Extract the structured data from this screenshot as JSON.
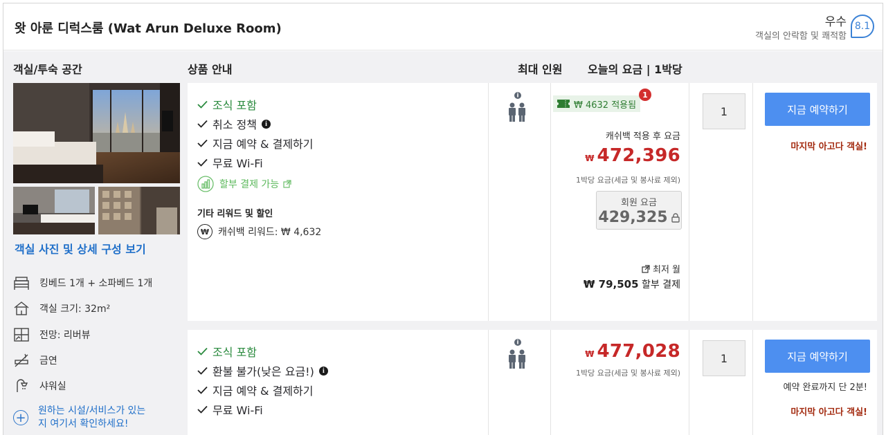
{
  "header": {
    "room_title": "왓 아룬 디럭스룸 (Wat Arun Deluxe Room)",
    "rating_word": "우수",
    "rating_sub": "객실의 안락함 및 쾌적함",
    "score": "8.1"
  },
  "columns": {
    "room": "객실/투숙 공간",
    "product": "상품 안내",
    "occupancy": "최대 인원",
    "price": "오늘의 요금 | 1박당"
  },
  "sidebar": {
    "photo_link": "객실 사진 및 상세 구성 보기",
    "amenities": [
      {
        "label": "킹베드 1개 + 소파베드 1개",
        "icon": "bed-icon"
      },
      {
        "label": "객실 크기: 32m²",
        "icon": "house-icon"
      },
      {
        "label": "전망: 리버뷰",
        "icon": "window-icon"
      },
      {
        "label": "금연",
        "icon": "no-smoking-icon"
      },
      {
        "label": "샤워실",
        "icon": "shower-icon"
      }
    ],
    "more_link": "원하는 시설/서비스가 있는\n지 여기서 확인하세요!"
  },
  "offers": [
    {
      "features": [
        "조식 포함",
        "취소 정책",
        "지금 예약 & 결제하기",
        "무료 Wi-Fi"
      ],
      "installment_label": "할부 결제 가능",
      "other_title": "기타 리워드 및 할인",
      "cashback_reward": "캐쉬백 리워드: ₩ 4,632",
      "cashback_badge": "₩ 4632 적용됨",
      "badge_count": "1",
      "after_label": "캐쉬백 적용 후 요금",
      "currency": "₩",
      "price": "472,396",
      "per_night": "1박당 요금(세금 및 봉사료 제외)",
      "member_label": "회원 요금",
      "member_price": "429,325",
      "lowest_month": "최저 월",
      "install_amount": "₩ 79,505",
      "install_suffix": "할부 결제",
      "quantity": "1",
      "book_label": "지금 예약하기",
      "last_chance": "마지막 아고다 객실!"
    },
    {
      "features": [
        "조식 포함",
        "환불 불가(낮은 요금!)",
        "지금 예약 & 결제하기",
        "무료 Wi-Fi"
      ],
      "currency": "₩",
      "price": "477,028",
      "per_night": "1박당 요금(세금 및 봉사료 제외)",
      "quantity": "1",
      "book_label": "지금 예약하기",
      "urgency": "예약 완료까지 단 2분!",
      "last_chance": "마지막 아고다 객실!"
    }
  ],
  "colors": {
    "accent": "#4d8ff0",
    "link": "#1f6fc9",
    "price_red": "#c62828",
    "included_green": "#2a8a3e"
  }
}
